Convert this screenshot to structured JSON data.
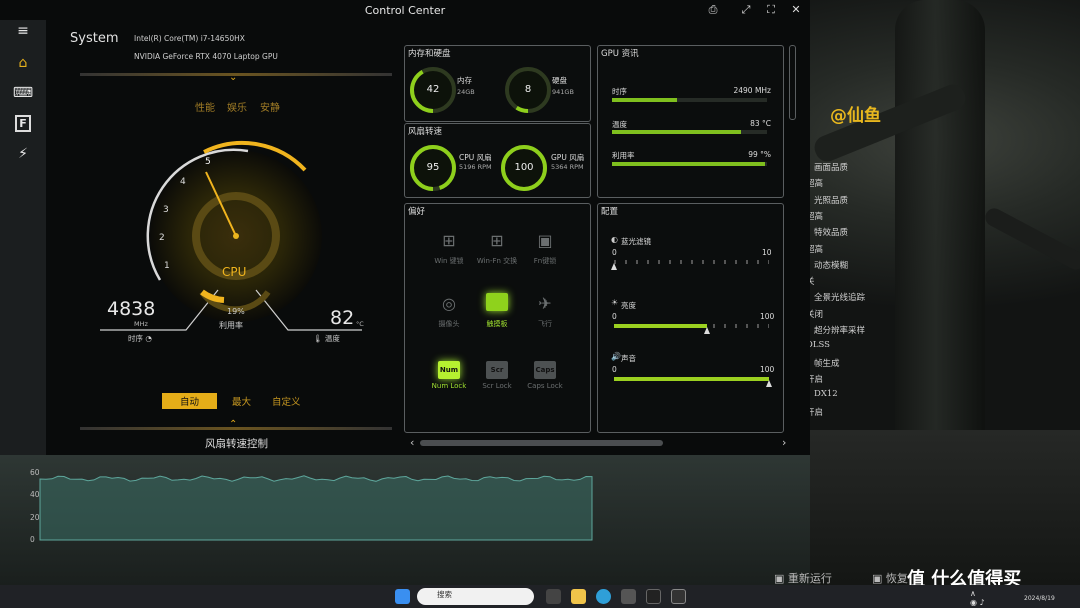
{
  "window": {
    "title": "Control Center"
  },
  "system": {
    "label": "System",
    "cpu_name": "Intel(R) Core(TM) i7-14650HX",
    "gpu_name": "NVIDIA GeForce RTX 4070 Laptop GPU"
  },
  "modes": {
    "items": [
      "性能",
      "娱乐",
      "安静"
    ],
    "active": "性能"
  },
  "cpu_gauge": {
    "label": "CPU",
    "clock": "4838",
    "clock_unit": "MHz",
    "clock_label": "时序",
    "usage": "19%",
    "usage_label": "利用率",
    "temp": "82",
    "temp_unit": "°C",
    "temp_label": "温度",
    "level_pct": 35,
    "ticks": [
      "1",
      "2",
      "3",
      "4",
      "5"
    ]
  },
  "fan_modes": {
    "items": [
      "自动",
      "最大",
      "自定义"
    ],
    "active": "自动",
    "title": "风扇转速控制"
  },
  "memory": {
    "title": "内存和硬盘",
    "ram_value": "42",
    "ram_label": "内存",
    "ram_size": "24GB",
    "disk_value": "8",
    "disk_label": "硬盘",
    "disk_size": "941GB"
  },
  "fans": {
    "title": "风扇转速",
    "cpu_value": "95",
    "cpu_label": "CPU 风扇",
    "cpu_rpm": "5196 RPM",
    "gpu_value": "100",
    "gpu_label": "GPU 风扇",
    "gpu_rpm": "5364 RPM"
  },
  "gpu_info": {
    "title": "GPU 资讯",
    "clock_label": "时序",
    "clock_value": "2490 MHz",
    "clock_pct": 42,
    "temp_label": "温度",
    "temp_value": "83 °C",
    "temp_pct": 83,
    "util_label": "利用率",
    "util_value": "99 °%",
    "util_pct": 99
  },
  "preferences": {
    "title": "偏好",
    "items": [
      {
        "label": "Win 键锁",
        "key": "",
        "on": false
      },
      {
        "label": "Win-Fn 交换",
        "key": "",
        "on": false
      },
      {
        "label": "Fn键锁",
        "key": "",
        "on": false
      },
      {
        "label": "摄像头",
        "key": "",
        "on": false
      },
      {
        "label": "触摸板",
        "key": "",
        "on": true
      },
      {
        "label": "飞行",
        "key": "",
        "on": false
      },
      {
        "label": "Num Lock",
        "key": "Num",
        "on": true
      },
      {
        "label": "Scr Lock",
        "key": "Scr",
        "on": false
      },
      {
        "label": "Caps Lock",
        "key": "Caps",
        "on": false
      }
    ]
  },
  "config": {
    "title": "配置",
    "sliders": [
      {
        "label": "蓝光滤镜",
        "min": "0",
        "max": "10",
        "value": 0
      },
      {
        "label": "亮度",
        "min": "0",
        "max": "100",
        "value": 60
      },
      {
        "label": "声音",
        "min": "0",
        "max": "100",
        "value": 100
      }
    ]
  },
  "overlay_chart": {
    "ticks": [
      "60",
      "40",
      "20",
      "0"
    ],
    "level": 55
  },
  "game_menu": {
    "handle": "@仙鱼",
    "items": [
      "画面品质",
      "超高",
      "光照品质",
      "超高",
      "特效品质",
      "超高",
      "动态模糊",
      "关",
      "全景光线追踪",
      "关闭",
      "超分辨率采样",
      "DLSS",
      "帧生成",
      "开启",
      "DX12",
      "开启"
    ],
    "bottom_left": "重新运行",
    "bottom_right": "恢复"
  },
  "watermark": "值 什么值得买",
  "taskbar": {
    "search_placeholder": "搜索",
    "date": "2024/8/19"
  }
}
